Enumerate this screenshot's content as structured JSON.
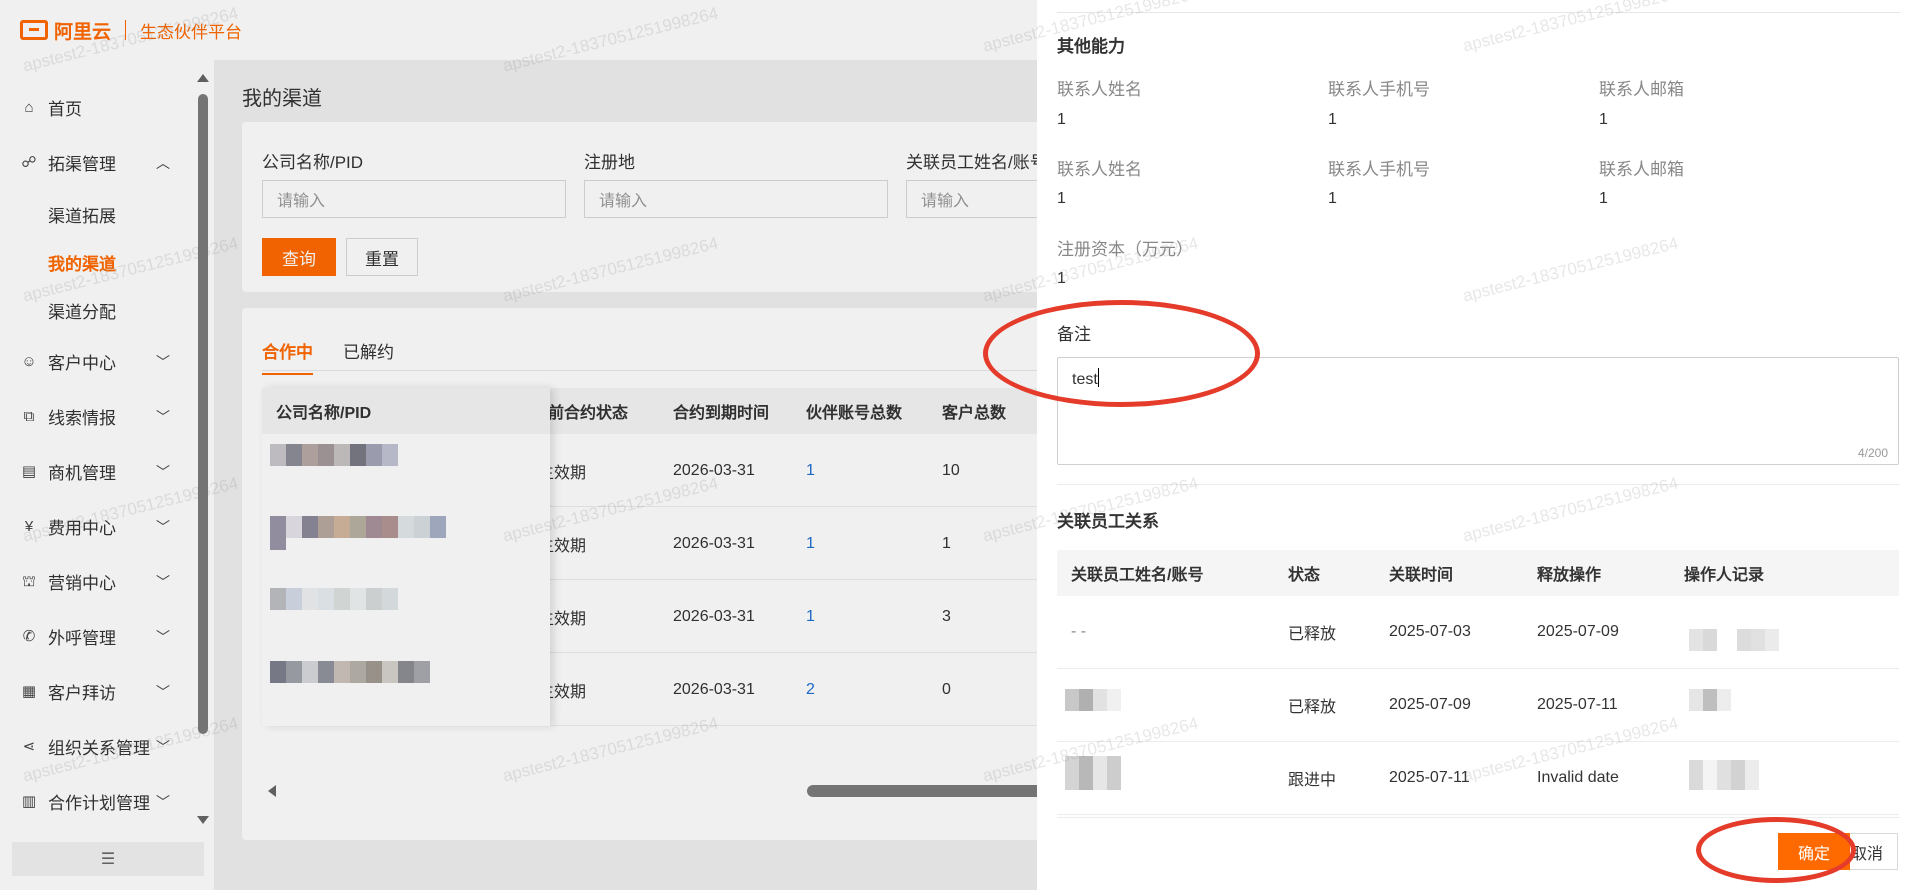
{
  "app": {
    "brand": "阿里云",
    "platform": "生态伙伴平台"
  },
  "sidebar": {
    "items": [
      {
        "label": "首页",
        "icon": "home-icon",
        "expandable": false
      },
      {
        "label": "拓渠管理",
        "icon": "channel-icon",
        "expandable": true,
        "expanded": true
      },
      {
        "label": "客户中心",
        "icon": "customer-icon",
        "expandable": true
      },
      {
        "label": "线索情报",
        "icon": "clue-icon",
        "expandable": true
      },
      {
        "label": "商机管理",
        "icon": "opportunity-icon",
        "expandable": true
      },
      {
        "label": "费用中心",
        "icon": "fee-icon",
        "expandable": true
      },
      {
        "label": "营销中心",
        "icon": "marketing-icon",
        "expandable": true
      },
      {
        "label": "外呼管理",
        "icon": "phone-icon",
        "expandable": true
      },
      {
        "label": "客户拜访",
        "icon": "calendar-icon",
        "expandable": true
      },
      {
        "label": "组织关系管理",
        "icon": "org-icon",
        "expandable": true
      },
      {
        "label": "合作计划管理",
        "icon": "plan-icon",
        "expandable": true
      }
    ],
    "sub_items": [
      {
        "label": "渠道拓展",
        "active": false
      },
      {
        "label": "我的渠道",
        "active": true
      },
      {
        "label": "渠道分配",
        "active": false
      }
    ],
    "collapse_icon": "menu-collapse-icon"
  },
  "main": {
    "title": "我的渠道",
    "filters": [
      {
        "label": "公司名称/PID",
        "placeholder": "请输入"
      },
      {
        "label": "注册地",
        "placeholder": "请输入"
      },
      {
        "label": "关联员工姓名/账号",
        "placeholder": "请输入"
      }
    ],
    "query_label": "查询",
    "reset_label": "重置",
    "tabs": [
      {
        "label": "合作中",
        "active": true
      },
      {
        "label": "已解约",
        "active": false
      }
    ],
    "columns": [
      "公司名称/PID",
      "前合约状态",
      "合约到期时间",
      "伙伴账号总数",
      "客户总数"
    ],
    "rows": [
      {
        "status": "生效期",
        "expire": "2026-03-31",
        "accounts": "1",
        "customers": "10"
      },
      {
        "status": "生效期",
        "expire": "2026-03-31",
        "accounts": "1",
        "customers": "1"
      },
      {
        "status": "生效期",
        "expire": "2026-03-31",
        "accounts": "1",
        "customers": "3"
      },
      {
        "status": "生效期",
        "expire": "2026-03-31",
        "accounts": "2",
        "customers": "0"
      }
    ]
  },
  "drawer": {
    "section_other": "其他能力",
    "contacts": [
      {
        "name_label": "联系人姓名",
        "name": "1",
        "phone_label": "联系人手机号",
        "phone": "1",
        "email_label": "联系人邮箱",
        "email": "1"
      },
      {
        "name_label": "联系人姓名",
        "name": "1",
        "phone_label": "联系人手机号",
        "phone": "1",
        "email_label": "联系人邮箱",
        "email": "1"
      }
    ],
    "capital_label": "注册资本（万元）",
    "capital_value": "1",
    "remark_label": "备注",
    "remark_value": "test",
    "remark_count": "4/200",
    "relation_title": "关联员工关系",
    "relation_columns": [
      "关联员工姓名/账号",
      "状态",
      "关联时间",
      "释放操作",
      "操作人记录"
    ],
    "relation_rows": [
      {
        "name": "- -",
        "status": "已释放",
        "time": "2025-07-03",
        "release": "2025-07-09"
      },
      {
        "name": "",
        "status": "已释放",
        "time": "2025-07-09",
        "release": "2025-07-11"
      },
      {
        "name": "",
        "status": "跟进中",
        "time": "2025-07-11",
        "release": "Invalid date"
      }
    ],
    "ok_label": "确定",
    "cancel_label": "取消"
  },
  "watermark": "apstest2-1837051251998264",
  "colors": {
    "brand": "#ff6a00",
    "link": "#1f6fd1",
    "annotation": "#e53b2a"
  }
}
